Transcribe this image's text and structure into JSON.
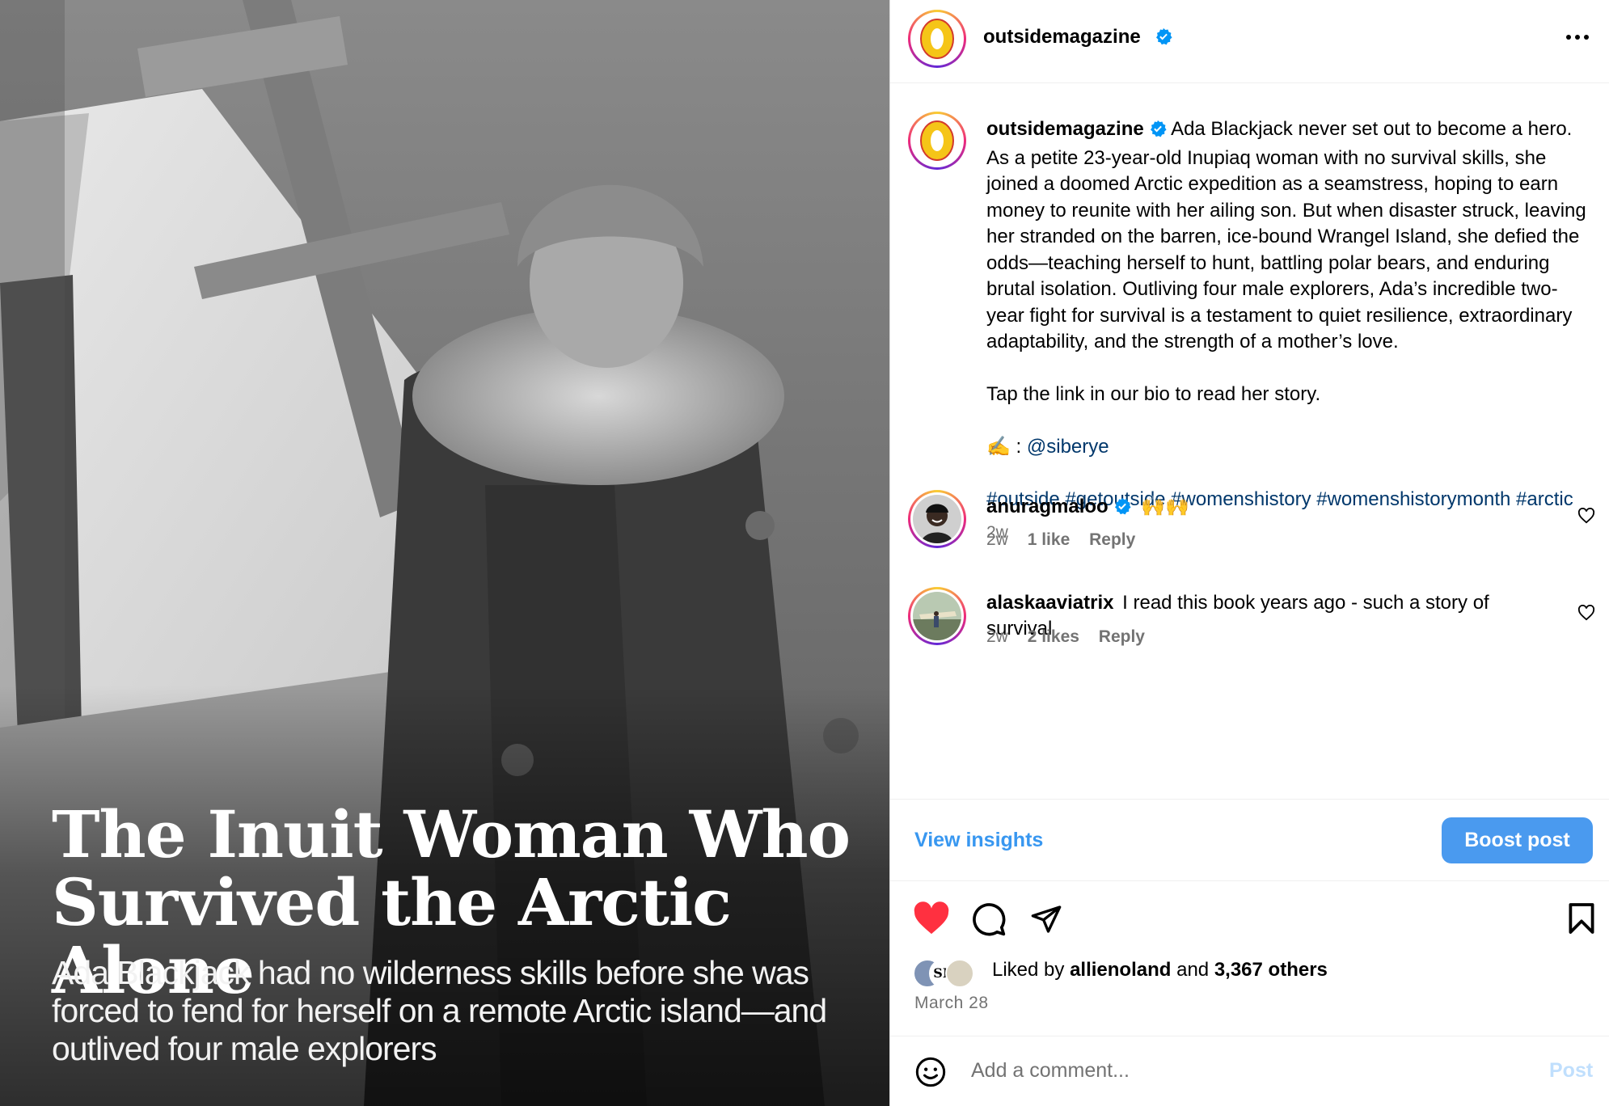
{
  "photo": {
    "headline_line1": "The Inuit Woman Who",
    "headline_line2": "Survived the Arctic Alone",
    "subhead": "Ada Blackjack had no wilderness skills before she was forced to fend for herself on a remote Arctic island—and outlived four male explorers"
  },
  "header": {
    "username": "outsidemagazine",
    "more_icon": "more-horizontal-icon"
  },
  "caption": {
    "username": "outsidemagazine",
    "body": "Ada Blackjack never set out to become a hero. As a petite 23-year-old Inupiaq woman with no survival skills, she joined a doomed Arctic expedition as a seamstress, hoping to earn money to reunite with her ailing son. But when disaster struck, leaving her stranded on the barren, ice-bound Wrangel Island, she defied the odds—teaching herself to hunt, battling polar bears, and enduring brutal isolation. Outliving four male explorers, Ada’s incredible two-year fight for survival is a testament to quiet resilience, extraordinary adaptability, and the strength of a mother’s love.",
    "cta": "Tap the link in our bio to read her story.",
    "credit_prefix": "✍️ : ",
    "credit_handle": "@siberye",
    "hashtags": "#outside #getoutside #womenshistory #womenshistorymonth #arctic",
    "age": "2w"
  },
  "comments": [
    {
      "username": "anuragmaloo",
      "text": "🙌🙌",
      "age": "2w",
      "likes": "1 like",
      "reply": "Reply"
    },
    {
      "username": "alaskaaviatrix",
      "text": "I read this book years ago - such a story of survival",
      "age": "2w",
      "likes": "2 likes",
      "reply": "Reply"
    }
  ],
  "insights": {
    "view_label": "View insights",
    "boost_label": "Boost post"
  },
  "actions": {
    "liked_by_prefix": "Liked by ",
    "liked_by_user": "allienoland",
    "liked_by_and": " and ",
    "liked_by_others": "3,367 others",
    "date": "March 28",
    "facepile_initials": "SK"
  },
  "add_comment": {
    "placeholder": "Add a comment...",
    "post_label": "Post"
  },
  "colors": {
    "accent": "#0095f6",
    "link": "#00376b",
    "heart": "#ff3040",
    "muted": "#737373"
  }
}
